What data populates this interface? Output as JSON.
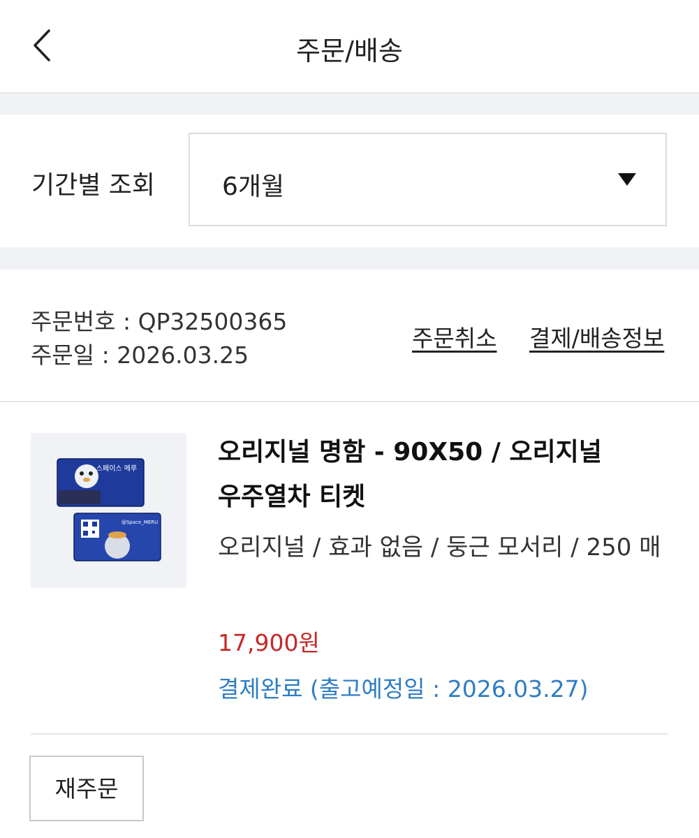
{
  "header": {
    "title": "주문/배송",
    "back_icon": "chevron-left-icon"
  },
  "period": {
    "label": "기간별 조회",
    "selected": "6개월",
    "dropdown_icon": "triangle-down-icon"
  },
  "order": {
    "number_label": "주문번호",
    "number": "QP32500365",
    "date_label": "주문일",
    "date": "2026.03.25",
    "cancel_link": "주문취소",
    "info_link": "결제/배송정보"
  },
  "item": {
    "name_line1": "오리지널 명함 - 90X50 / 오리지널",
    "name_line2": "우주열차 티켓",
    "options": "오리지널 / 효과 없음 / 둥근 모서리 / 250 매",
    "price": "17,900원",
    "status": "결제완료 (출고예정일 : 2026.03.27)",
    "thumb_text_top": "스페이스 메루",
    "thumb_text_bottom": "@Space_MERU"
  },
  "actions": {
    "reorder": "재주문"
  },
  "colors": {
    "price": "#c62828",
    "status": "#2f7dc2",
    "gap": "#f1f2f6"
  }
}
